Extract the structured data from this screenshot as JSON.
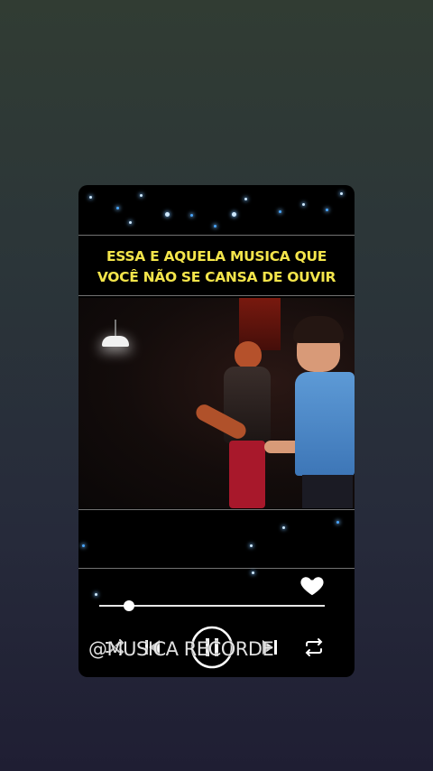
{
  "player": {
    "caption_line1": "ESSA E AQUELA MUSICA QUE",
    "caption_line2": "VOCÊ NÃO SE CANSA DE OUVIR",
    "watermark": "@MUSICA RECORDE",
    "progress": 0.13,
    "liked": true,
    "is_playing": true,
    "icons": {
      "like": "heart-icon",
      "shuffle": "shuffle-icon",
      "previous": "skip-previous-icon",
      "play_pause": "pause-icon",
      "next": "skip-next-icon",
      "repeat": "repeat-icon"
    }
  },
  "colors": {
    "caption": "#f4e54b",
    "card_background": "#000000",
    "star_glow": "#48a6ff"
  }
}
